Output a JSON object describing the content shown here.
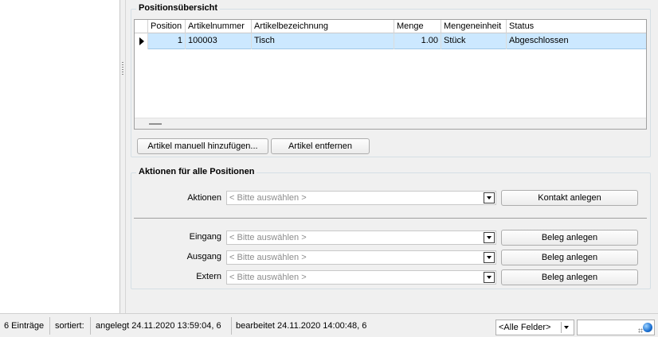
{
  "sections": {
    "positions_title": "Positionsübersicht",
    "actions_title": "Aktionen für alle Positionen"
  },
  "grid": {
    "columns": [
      "Position",
      "Artikelnummer",
      "Artikelbezeichnung",
      "Menge",
      "Mengeneinheit",
      "Status"
    ],
    "rows": [
      {
        "position": "1",
        "artikelnummer": "100003",
        "artikelbezeichnung": "Tisch",
        "menge": "1.00",
        "mengeneinheit": "Stück",
        "status": "Abgeschlossen"
      }
    ]
  },
  "buttons": {
    "add_manual": "Artikel manuell hinzufügen...",
    "remove": "Artikel entfernen",
    "create_contact": "Kontakt anlegen",
    "create_doc_in": "Beleg anlegen",
    "create_doc_out": "Beleg anlegen",
    "create_doc_ext": "Beleg anlegen"
  },
  "actions": {
    "aktionen_label": "Aktionen",
    "eingang_label": "Eingang",
    "ausgang_label": "Ausgang",
    "extern_label": "Extern",
    "placeholder": "< Bitte auswählen >"
  },
  "statusbar": {
    "count": "6 Einträge",
    "sorted": "sortiert:",
    "created": "angelegt 24.11.2020 13:59:04,  6",
    "edited": "bearbeitet 24.11.2020 14:00:48,  6",
    "field_filter": "<Alle Felder>",
    "search_value": ""
  },
  "icons": {
    "row_indicator": "current-row-arrow-icon",
    "dropdown": "chevron-down-icon",
    "search_go": "search-go-globe-icon"
  },
  "colors": {
    "selected_row": "#cce8ff",
    "window_bg": "#f0f0f0"
  }
}
